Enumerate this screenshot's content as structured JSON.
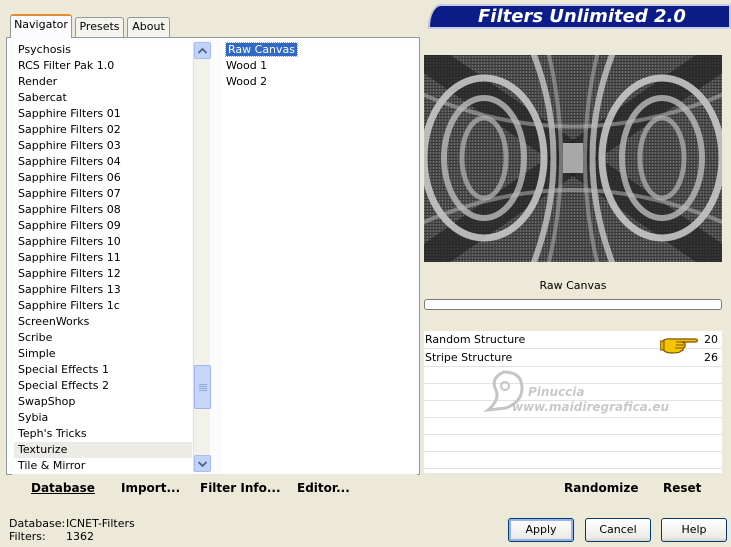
{
  "tabs": [
    {
      "label": "Navigator",
      "active": true
    },
    {
      "label": "Presets",
      "active": false
    },
    {
      "label": "About",
      "active": false
    }
  ],
  "banner": {
    "title": "Filters Unlimited 2.0",
    "color": "#0c1d8a"
  },
  "categories": {
    "items": [
      "Psychosis",
      "RCS Filter Pak 1.0",
      "Render",
      "Sabercat",
      "Sapphire Filters 01",
      "Sapphire Filters 02",
      "Sapphire Filters 03",
      "Sapphire Filters 04",
      "Sapphire Filters 06",
      "Sapphire Filters 07",
      "Sapphire Filters 08",
      "Sapphire Filters 09",
      "Sapphire Filters 10",
      "Sapphire Filters 11",
      "Sapphire Filters 12",
      "Sapphire Filters 13",
      "Sapphire Filters 1c",
      "ScreenWorks",
      "Scribe",
      "Simple",
      "Special Effects 1",
      "Special Effects 2",
      "SwapShop",
      "Sybia",
      "Teph's Tricks",
      "Texturize",
      "Tile & Mirror"
    ],
    "selected": "Texturize"
  },
  "filters": {
    "items": [
      "Raw Canvas",
      "Wood 1",
      "Wood 2"
    ],
    "selected": "Raw Canvas",
    "selection_color": "#316ac5"
  },
  "preview": {
    "filter_name": "Raw Canvas"
  },
  "params": [
    {
      "label": "Random Structure",
      "value": "20"
    },
    {
      "label": "Stripe Structure",
      "value": "26"
    }
  ],
  "watermark": {
    "line1": "Pinuccia",
    "line2": "www.maidiregrafica.eu"
  },
  "bottom_left": {
    "database": "Database",
    "import": "Import...",
    "filter_info": "Filter Info...",
    "editor": "Editor..."
  },
  "bottom_right": {
    "randomize": "Randomize",
    "reset": "Reset"
  },
  "status": {
    "database_label": "Database:",
    "database_value": "ICNET-Filters",
    "filters_label": "Filters:",
    "filters_value": "1362"
  },
  "buttons": {
    "apply": "Apply",
    "cancel": "Cancel",
    "help": "Help"
  }
}
